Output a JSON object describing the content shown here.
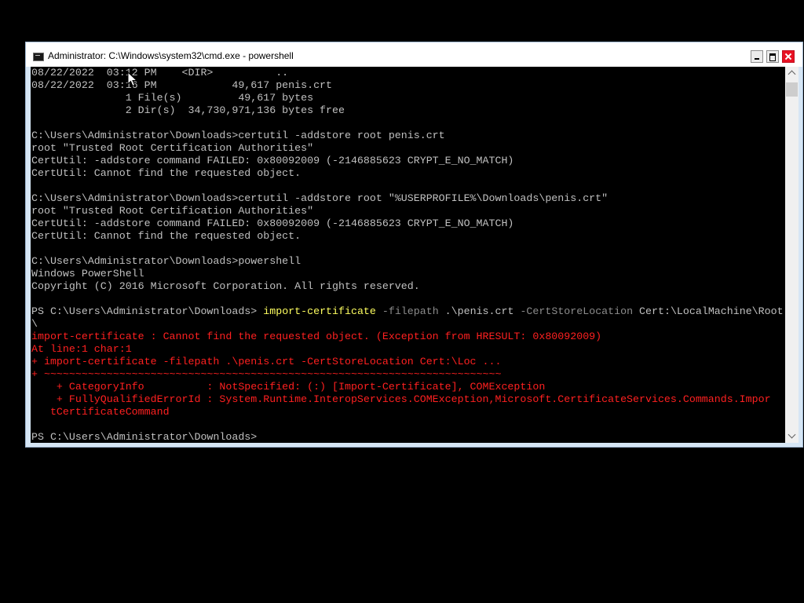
{
  "window": {
    "title": "Administrator: C:\\Windows\\system32\\cmd.exe - powershell",
    "icon": "cmd-icon",
    "controls": [
      "minimize-icon",
      "maximize-icon",
      "close-icon"
    ]
  },
  "console": {
    "lines": [
      [
        {
          "t": "08/22/2022  03:12 PM    <DIR>          ..",
          "c": "def"
        }
      ],
      [
        {
          "t": "08/22/2022  03:16 PM            49,617 penis.crt",
          "c": "def"
        }
      ],
      [
        {
          "t": "               1 File(s)         49,617 bytes",
          "c": "def"
        }
      ],
      [
        {
          "t": "               2 Dir(s)  34,730,971,136 bytes free",
          "c": "def"
        }
      ],
      [
        {
          "t": "",
          "c": "def"
        }
      ],
      [
        {
          "t": "C:\\Users\\Administrator\\Downloads>certutil -addstore root penis.crt",
          "c": "def"
        }
      ],
      [
        {
          "t": "root \"Trusted Root Certification Authorities\"",
          "c": "def"
        }
      ],
      [
        {
          "t": "CertUtil: -addstore command FAILED: 0x80092009 (-2146885623 CRYPT_E_NO_MATCH)",
          "c": "def"
        }
      ],
      [
        {
          "t": "CertUtil: Cannot find the requested object.",
          "c": "def"
        }
      ],
      [
        {
          "t": "",
          "c": "def"
        }
      ],
      [
        {
          "t": "C:\\Users\\Administrator\\Downloads>certutil -addstore root \"%USERPROFILE%\\Downloads\\penis.crt\"",
          "c": "def"
        }
      ],
      [
        {
          "t": "root \"Trusted Root Certification Authorities\"",
          "c": "def"
        }
      ],
      [
        {
          "t": "CertUtil: -addstore command FAILED: 0x80092009 (-2146885623 CRYPT_E_NO_MATCH)",
          "c": "def"
        }
      ],
      [
        {
          "t": "CertUtil: Cannot find the requested object.",
          "c": "def"
        }
      ],
      [
        {
          "t": "",
          "c": "def"
        }
      ],
      [
        {
          "t": "C:\\Users\\Administrator\\Downloads>powershell",
          "c": "def"
        }
      ],
      [
        {
          "t": "Windows PowerShell",
          "c": "def"
        }
      ],
      [
        {
          "t": "Copyright (C) 2016 Microsoft Corporation. All rights reserved.",
          "c": "def"
        }
      ],
      [
        {
          "t": "",
          "c": "def"
        }
      ],
      [
        {
          "t": "PS C:\\Users\\Administrator\\Downloads> ",
          "c": "def"
        },
        {
          "t": "import-certificate",
          "c": "cmd"
        },
        {
          "t": " -filepath ",
          "c": "param"
        },
        {
          "t": ".\\penis.crt ",
          "c": "def"
        },
        {
          "t": "-CertStoreLocation ",
          "c": "param"
        },
        {
          "t": "Cert:\\LocalMachine\\Root",
          "c": "def"
        }
      ],
      [
        {
          "t": "\\",
          "c": "def"
        }
      ],
      [
        {
          "t": "import-certificate : Cannot find the requested object. (Exception from HRESULT: 0x80092009)",
          "c": "err"
        }
      ],
      [
        {
          "t": "At line:1 char:1",
          "c": "err"
        }
      ],
      [
        {
          "t": "+ import-certificate -filepath .\\penis.crt -CertStoreLocation Cert:\\Loc ...",
          "c": "err"
        }
      ],
      [
        {
          "t": "+ ~~~~~~~~~~~~~~~~~~~~~~~~~~~~~~~~~~~~~~~~~~~~~~~~~~~~~~~~~~~~~~~~~~~~~~~~~",
          "c": "err"
        }
      ],
      [
        {
          "t": "    + CategoryInfo          : NotSpecified: (:) [Import-Certificate], COMException",
          "c": "err"
        }
      ],
      [
        {
          "t": "    + FullyQualifiedErrorId : System.Runtime.InteropServices.COMException,Microsoft.CertificateServices.Commands.Impor",
          "c": "err"
        }
      ],
      [
        {
          "t": "   tCertificateCommand",
          "c": "err"
        }
      ],
      [
        {
          "t": "",
          "c": "def"
        }
      ],
      [
        {
          "t": "PS C:\\Users\\Administrator\\Downloads>",
          "c": "def"
        }
      ]
    ]
  },
  "colors": {
    "default_text": "#c0c0c0",
    "command_text": "#ffff60",
    "parameter_text": "#8c8c8c",
    "error_text": "#ff2020",
    "console_background": "#000000"
  },
  "scrollbar": {
    "up_icon": "scroll-up-arrow-icon",
    "down_icon": "scroll-down-arrow-icon"
  },
  "cursor": {
    "icon": "mouse-pointer-icon"
  }
}
